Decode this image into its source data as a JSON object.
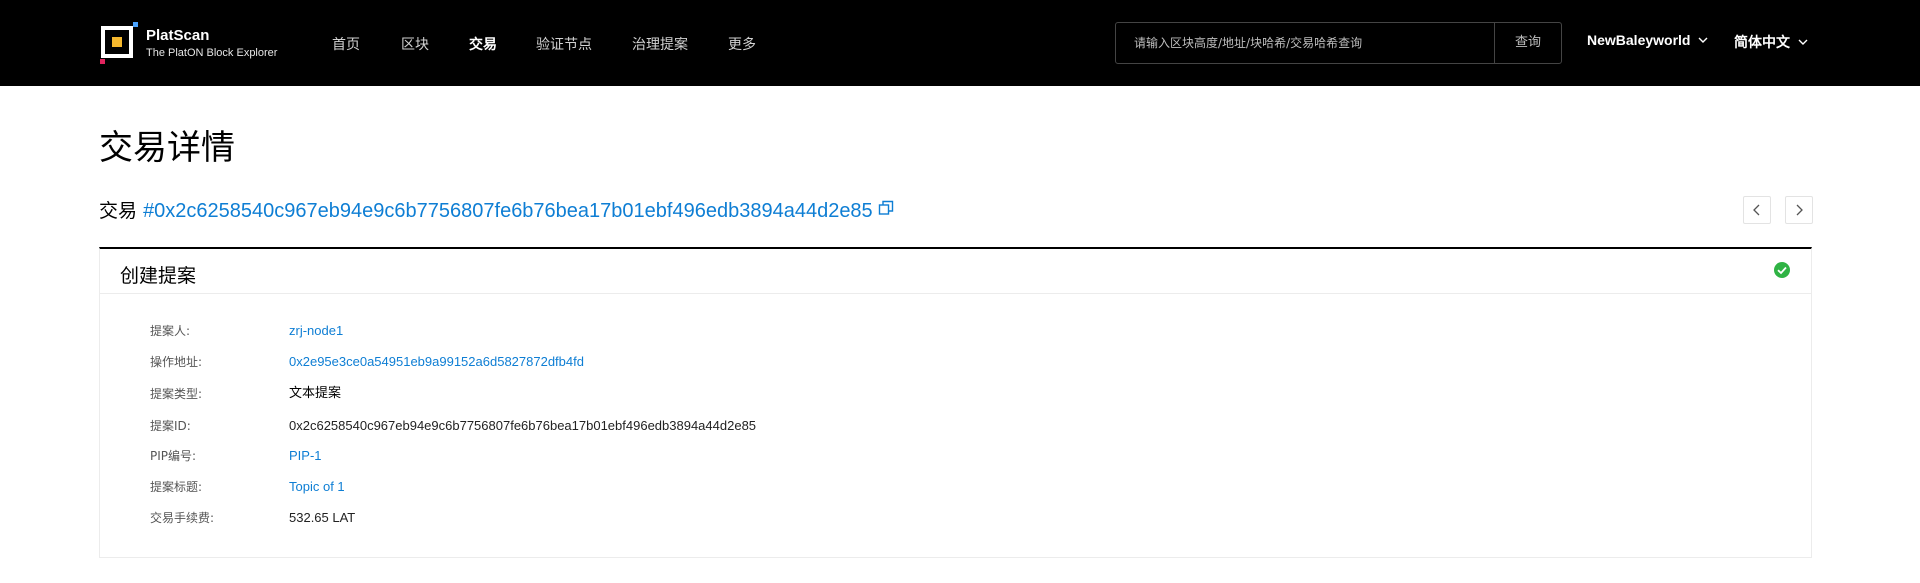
{
  "header": {
    "logo": {
      "title": "PlatScan",
      "subtitle": "The PlatON Block Explorer"
    },
    "nav": [
      {
        "label": "首页",
        "active": false
      },
      {
        "label": "区块",
        "active": false
      },
      {
        "label": "交易",
        "active": true
      },
      {
        "label": "验证节点",
        "active": false
      },
      {
        "label": "治理提案",
        "active": false
      },
      {
        "label": "更多",
        "active": false
      }
    ],
    "search": {
      "placeholder": "请输入区块高度/地址/块哈希/交易哈希查询",
      "button": "查询"
    },
    "network": "NewBaleyworld",
    "language": "简体中文"
  },
  "page": {
    "title": "交易详情",
    "tx_label": "交易",
    "tx_hash": "#0x2c6258540c967eb94e9c6b7756807fe6b76bea17b01ebf496edb3894a44d2e85"
  },
  "card": {
    "title": "创建提案",
    "status": "success",
    "rows": [
      {
        "label": "提案人:",
        "value": "zrj-node1"
      },
      {
        "label": "操作地址:",
        "value": "0x2e95e3ce0a54951eb9a99152a6d5827872dfb4fd"
      },
      {
        "label": "提案类型:",
        "value": "文本提案"
      },
      {
        "label": "提案ID:",
        "value": "0x2c6258540c967eb94e9c6b7756807fe6b76bea17b01ebf496edb3894a44d2e85"
      },
      {
        "label": "PIP编号:",
        "value": "PIP-1"
      },
      {
        "label": "提案标题:",
        "value": "Topic of 1"
      },
      {
        "label": "交易手续费:",
        "value": "532.65 LAT"
      }
    ]
  },
  "colors": {
    "accent": "#0e7ed4",
    "header_bg": "#000000",
    "success": "#2fb344",
    "logo_accent": "#f5b82e",
    "logo_red": "#e0245e"
  }
}
